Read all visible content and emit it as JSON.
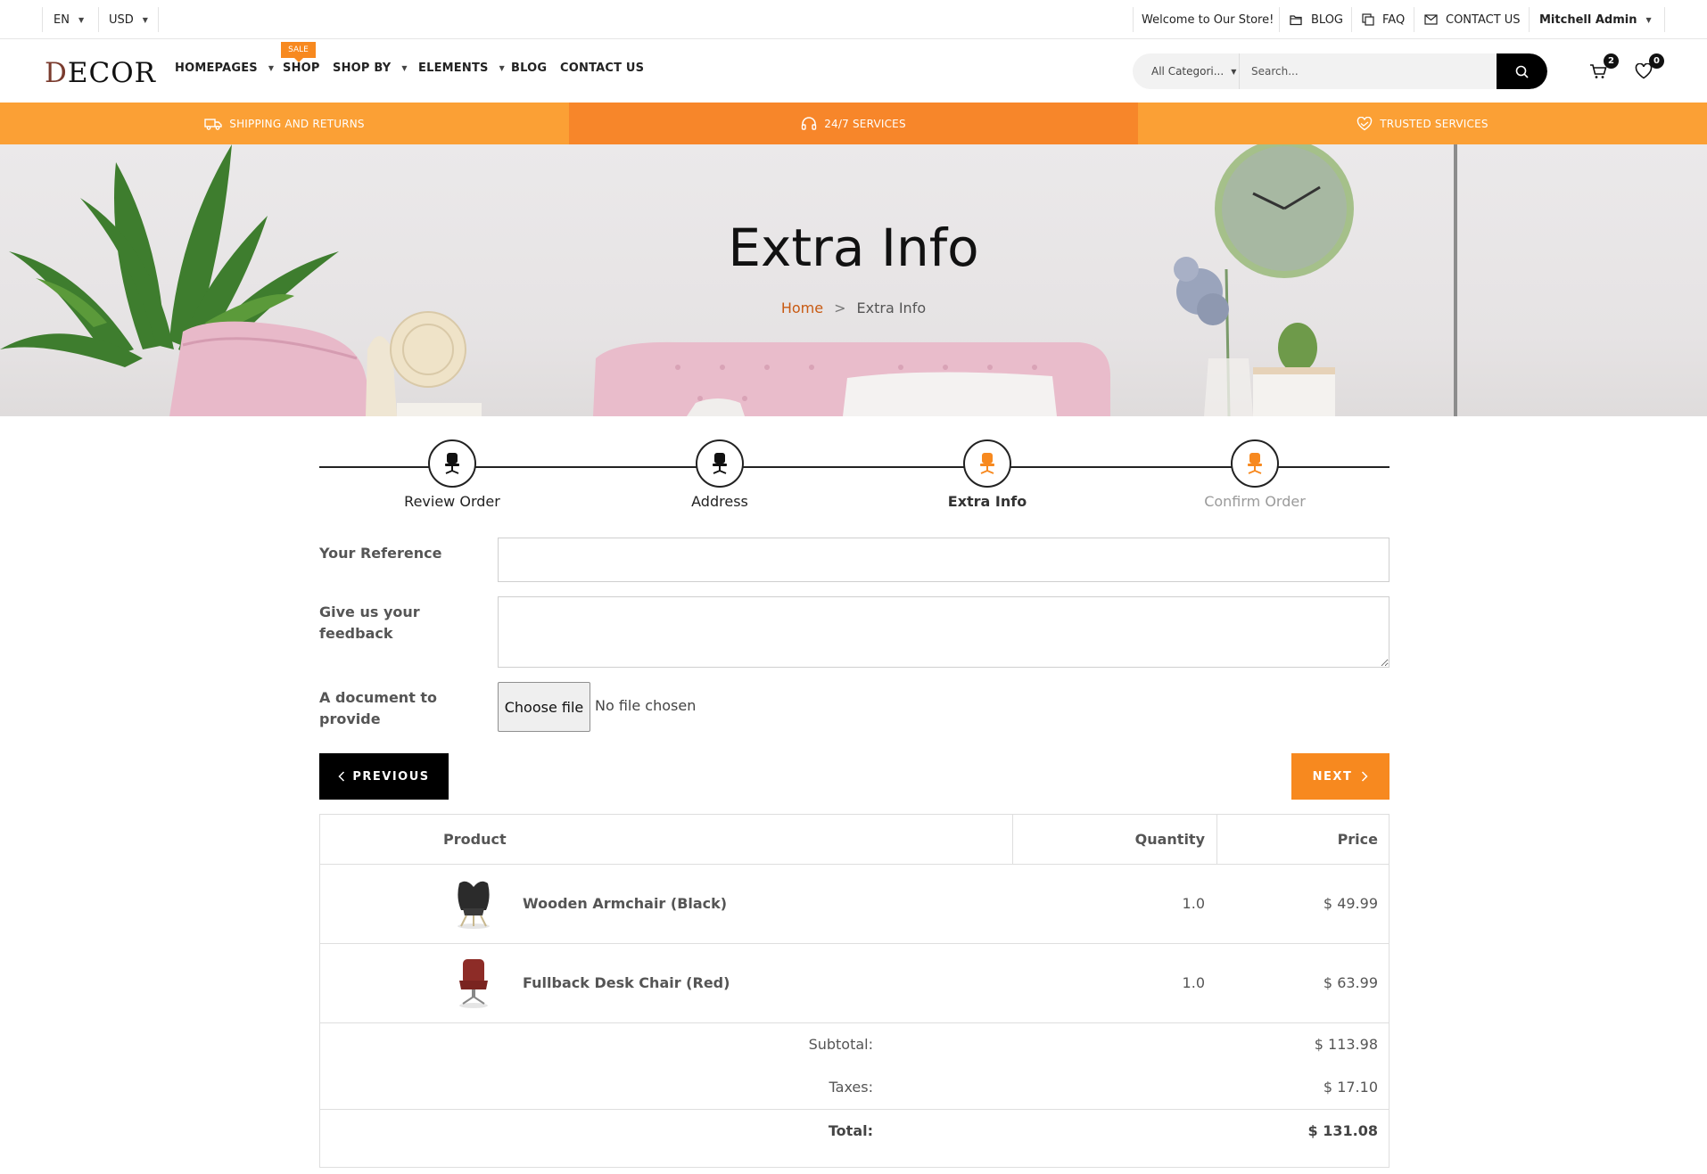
{
  "topbar": {
    "language": "EN",
    "currency": "USD",
    "welcome": "Welcome to Our Store!",
    "blog": "BLOG",
    "faq": "FAQ",
    "contact": "CONTACT US",
    "user": "Mitchell Admin"
  },
  "header": {
    "logo_initial": "D",
    "logo_rest": "ECOR",
    "nav": {
      "homepages": "HOMEPAGES",
      "shop": "SHOP",
      "shop_badge": "SALE",
      "shop_by": "SHOP BY",
      "elements": "ELEMENTS",
      "blog": "BLOG",
      "contact": "CONTACT US"
    },
    "search": {
      "category": "All Categori...",
      "placeholder": "Search..."
    },
    "cart_count": "2",
    "wishlist_count": "0"
  },
  "services": {
    "shipping": "SHIPPING AND RETURNS",
    "support": "24/7 SERVICES",
    "trusted": "TRUSTED SERVICES"
  },
  "colors": {
    "accent": "#f7891f",
    "strip_light": "#fba035",
    "strip_dark": "#f7862a",
    "breadcrumb_home": "#c85a12"
  },
  "hero": {
    "title": "Extra Info",
    "breadcrumb_home": "Home",
    "breadcrumb_sep": ">",
    "breadcrumb_current": "Extra Info"
  },
  "wizard": {
    "steps": [
      {
        "label": "Review Order",
        "state": "done",
        "icon": "chair-icon"
      },
      {
        "label": "Address",
        "state": "done",
        "icon": "chair-icon"
      },
      {
        "label": "Extra Info",
        "state": "active",
        "icon": "chair-icon"
      },
      {
        "label": "Confirm Order",
        "state": "todo",
        "icon": "chair-icon"
      }
    ]
  },
  "form": {
    "reference_label": "Your Reference",
    "reference_value": "",
    "feedback_label_1": "Give us your",
    "feedback_label_2": "feedback",
    "feedback_value": "",
    "document_label_1": "A document to",
    "document_label_2": "provide",
    "file_button": "Choose file",
    "file_status": "No file chosen"
  },
  "buttons": {
    "previous": "PREVIOUS",
    "next": "NEXT"
  },
  "summary": {
    "headers": {
      "product": "Product",
      "quantity": "Quantity",
      "price": "Price"
    },
    "items": [
      {
        "name": "Wooden Armchair (Black)",
        "quantity": "1.0",
        "price": "$ 49.99",
        "image": "black-armchair-image"
      },
      {
        "name": "Fullback Desk Chair (Red)",
        "quantity": "1.0",
        "price": "$ 63.99",
        "image": "red-desk-chair-image"
      }
    ],
    "subtotal_label": "Subtotal:",
    "subtotal": "$ 113.98",
    "taxes_label": "Taxes:",
    "taxes": "$ 17.10",
    "total_label": "Total:",
    "total": "$ 131.08"
  }
}
